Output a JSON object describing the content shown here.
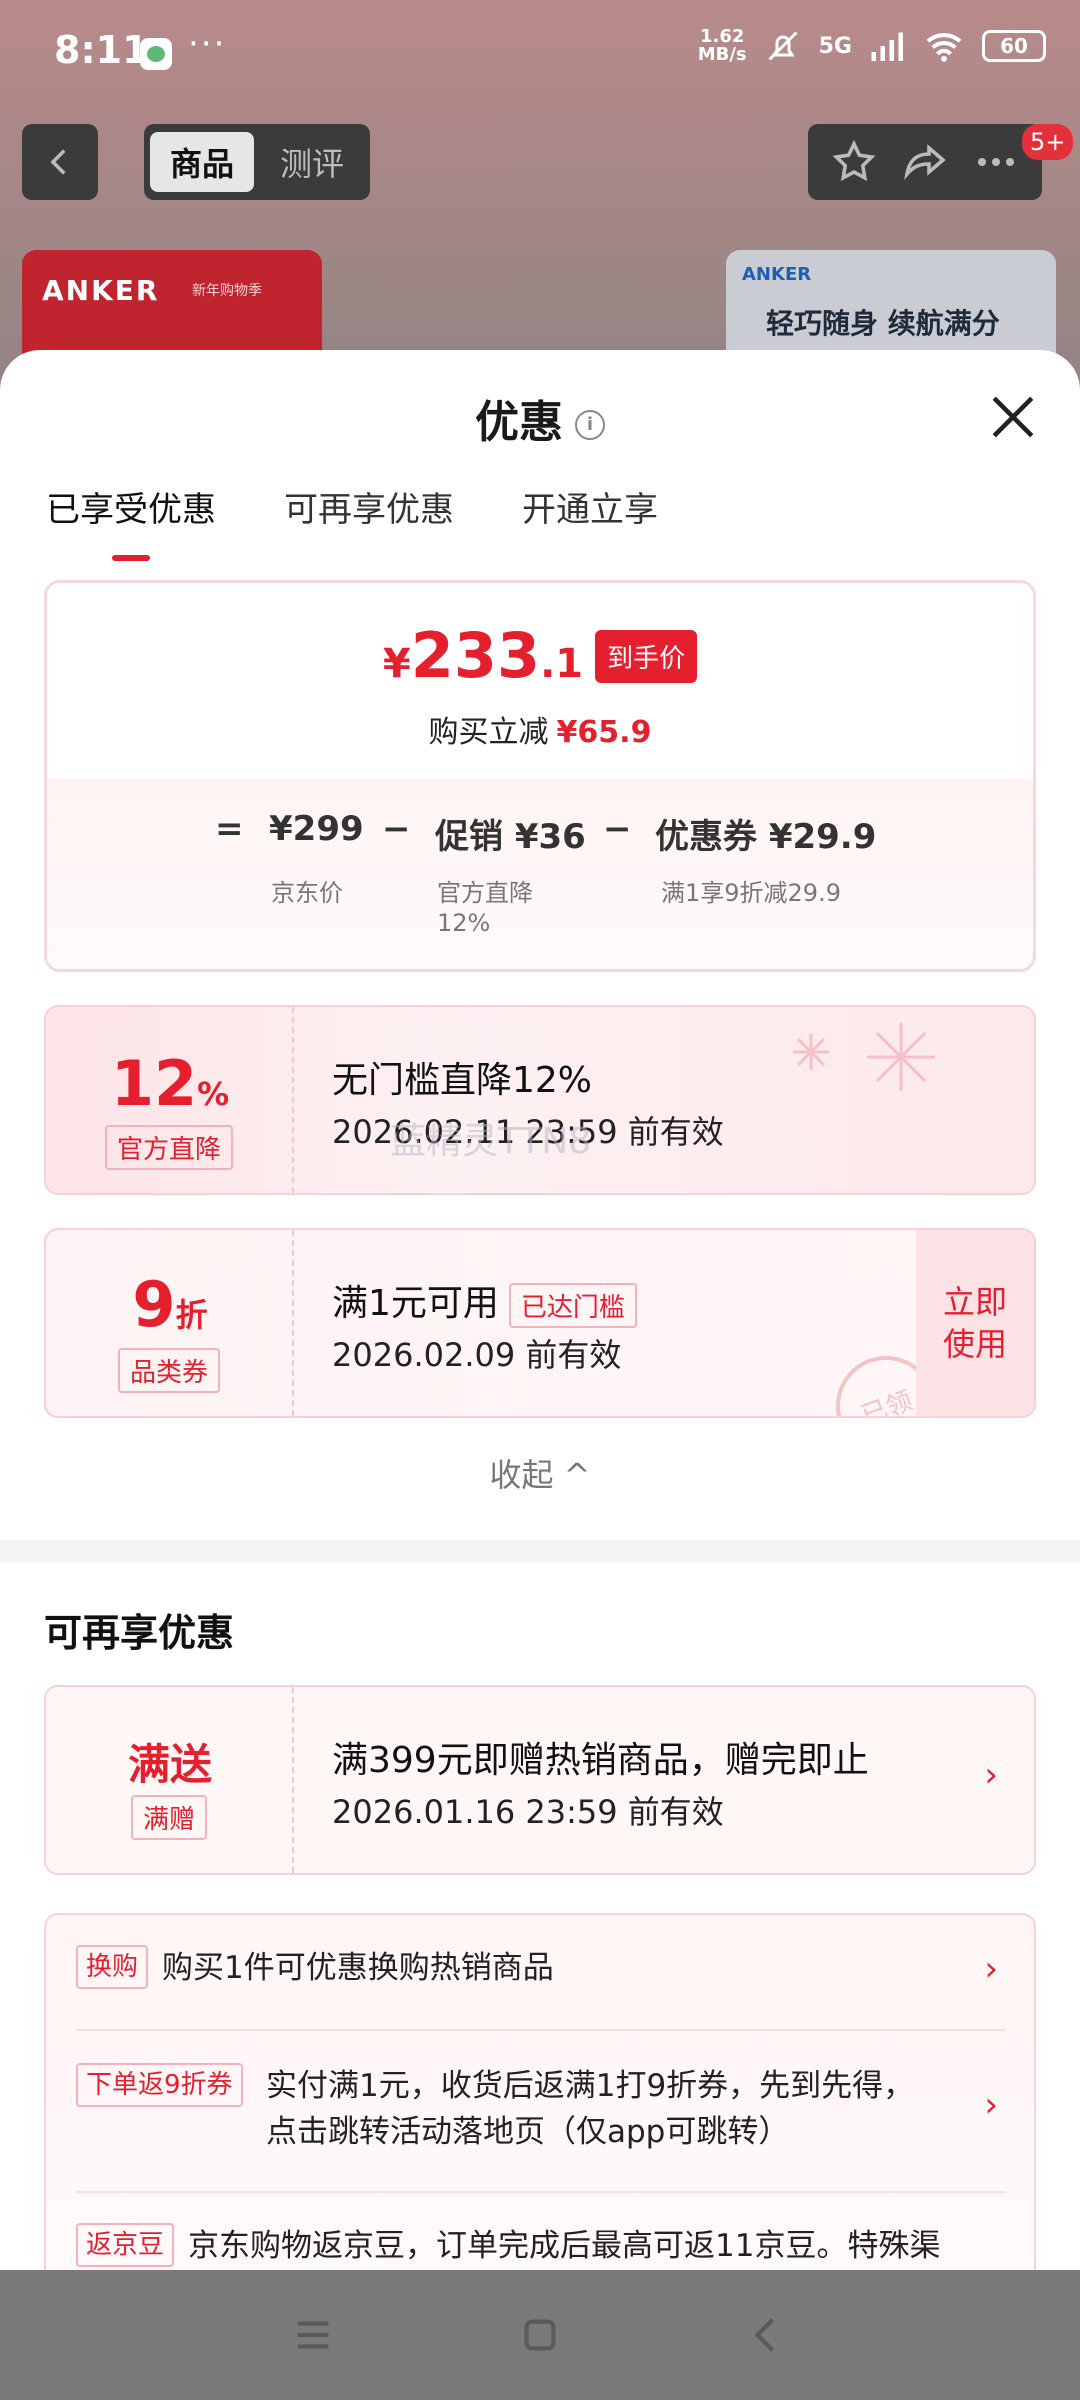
{
  "status_bar": {
    "time": "8:11",
    "dots": "···",
    "net_speed_value": "1.62",
    "net_speed_unit": "MB/s",
    "network": "5G",
    "battery": "60"
  },
  "topbar": {
    "tab_product": "商品",
    "tab_review": "测评",
    "badge": "5+"
  },
  "background_promos": {
    "left_brand": "ANKER",
    "left_sub": "新年购物季",
    "right_brand": "ANKER",
    "right_slogan": "轻巧随身 续航满分"
  },
  "sheet": {
    "title": "优惠",
    "info_icon": "i",
    "tabs": [
      "已享受优惠",
      "可再享优惠",
      "开通立享"
    ]
  },
  "price_card": {
    "currency": "¥",
    "price_main": "233",
    "price_decimal": ".1",
    "price_tag": "到手价",
    "reduce_label": "购买立减",
    "reduce_value": "¥65.9",
    "eq": "=",
    "minus": "−",
    "jd_price": "¥299",
    "jd_price_label": "京东价",
    "promo": "促销 ¥36",
    "promo_label_1": "官方直降",
    "promo_label_2": "12%",
    "coupon": "优惠券 ¥29.9",
    "coupon_label": "满1享9折减29.9"
  },
  "coupon_official": {
    "value": "12",
    "unit": "%",
    "label": "官方直降",
    "title": "无门槛直降12%",
    "expiry": "2026.02.11 23:59 前有效",
    "watermark": "蓝精灵TTN8"
  },
  "coupon_category": {
    "value": "9",
    "unit": "折",
    "label": "品类券",
    "title": "满1元可用",
    "badge": "已达门槛",
    "expiry": "2026.02.09 前有效",
    "action_line1": "立即",
    "action_line2": "使用",
    "stamp": "已领"
  },
  "collapse_label": "收起 ^",
  "more_section": {
    "title": "可再享优惠",
    "gift": {
      "big": "满送",
      "label": "满赠",
      "title": "满399元即赠热销商品，赠完即止",
      "expiry": "2026.01.16 23:59 前有效"
    },
    "items": [
      {
        "tag": "换购",
        "text": "购买1件可优惠换购热销商品"
      },
      {
        "tag": "下单返9折券",
        "text": "实付满1元，收货后返满1打9折券，先到先得，",
        "text2": "点击跳转活动落地页（仅app可跳转）"
      },
      {
        "tag": "返京豆",
        "text": "京东购物返京豆，订单完成后最高可返11京豆。特殊渠"
      }
    ],
    "chevron": "›"
  },
  "colors": {
    "accent": "#e4202e",
    "accent_light": "#fde4e6"
  },
  "icons": [
    "back-icon",
    "star-icon",
    "share-icon",
    "more-icon",
    "info-icon",
    "close-icon",
    "chevron-up-icon",
    "chevron-right-icon",
    "menu-icon",
    "home-icon",
    "nav-back-icon"
  ]
}
